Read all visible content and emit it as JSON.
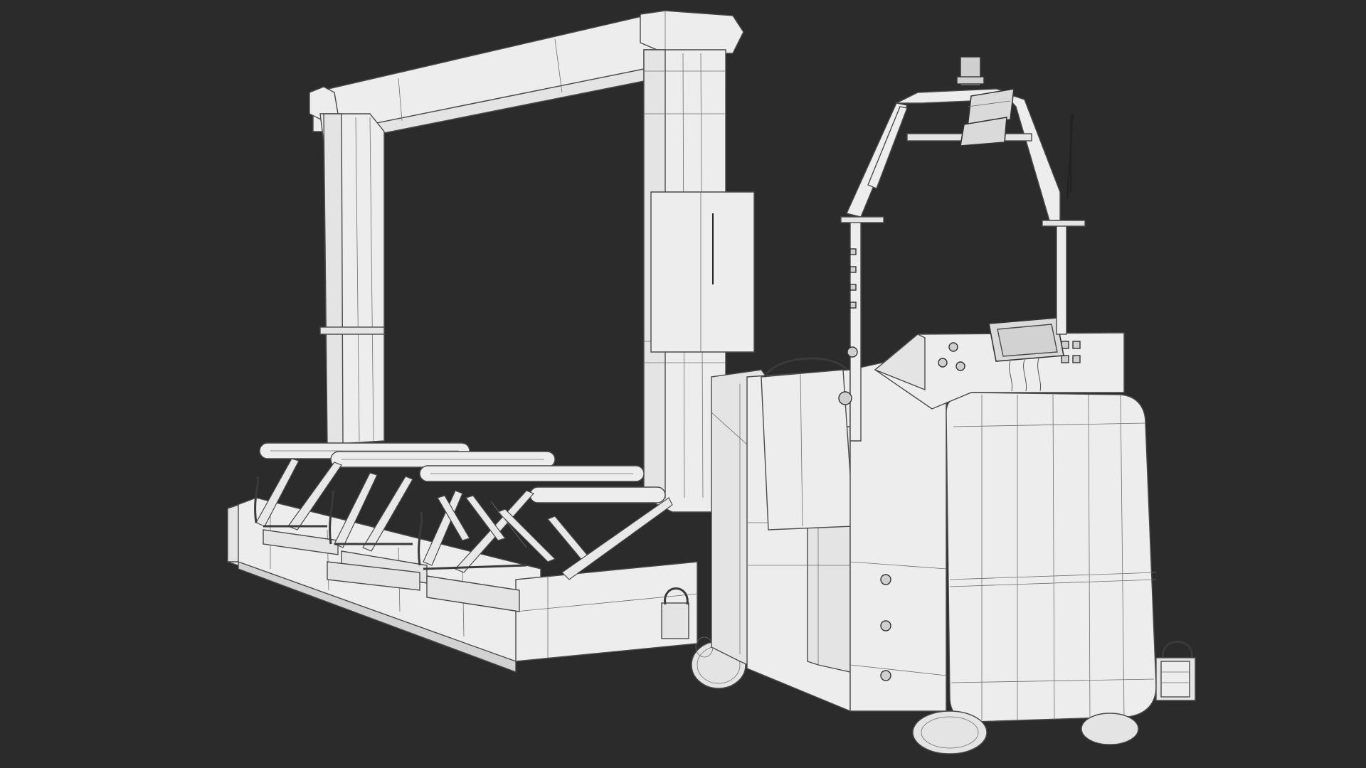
{
  "scene": {
    "background_color": "#2b2b2b",
    "model_fill_color": "#e4e4e4",
    "wireframe_color": "#4a4a4a"
  }
}
